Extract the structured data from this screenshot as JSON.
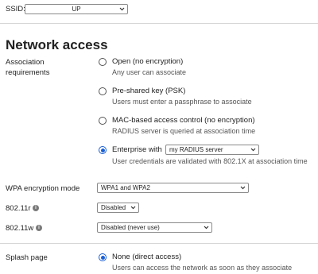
{
  "ssid": {
    "label": "SSID:",
    "value": "UP"
  },
  "network_access": {
    "title": "Network access",
    "association_label_line1": "Association",
    "association_label_line2": "requirements",
    "options": [
      {
        "label": "Open (no encryption)",
        "description": "Any user can associate",
        "selected": false
      },
      {
        "label": "Pre-shared key (PSK)",
        "description": "Users must enter a passphrase to associate",
        "selected": false
      },
      {
        "label": "MAC-based access control (no encryption)",
        "description": "RADIUS server is queried at association time",
        "selected": false
      },
      {
        "label": "Enterprise with",
        "select_value": "my RADIUS server",
        "description": "User credentials are validated with 802.1X at association time",
        "selected": true
      }
    ]
  },
  "wpa": {
    "label": "WPA encryption mode",
    "value": "WPA1 and WPA2"
  },
  "r80211r": {
    "label": "802.11r",
    "value": "Disabled"
  },
  "r80211w": {
    "label": "802.11w",
    "value": "Disabled (never use)"
  },
  "splash": {
    "label": "Splash page",
    "option_label": "None (direct access)",
    "option_description": "Users can access the network as soon as they associate"
  },
  "colors": {
    "accent": "#1a5fd6",
    "divider": "#d6d6d6"
  }
}
